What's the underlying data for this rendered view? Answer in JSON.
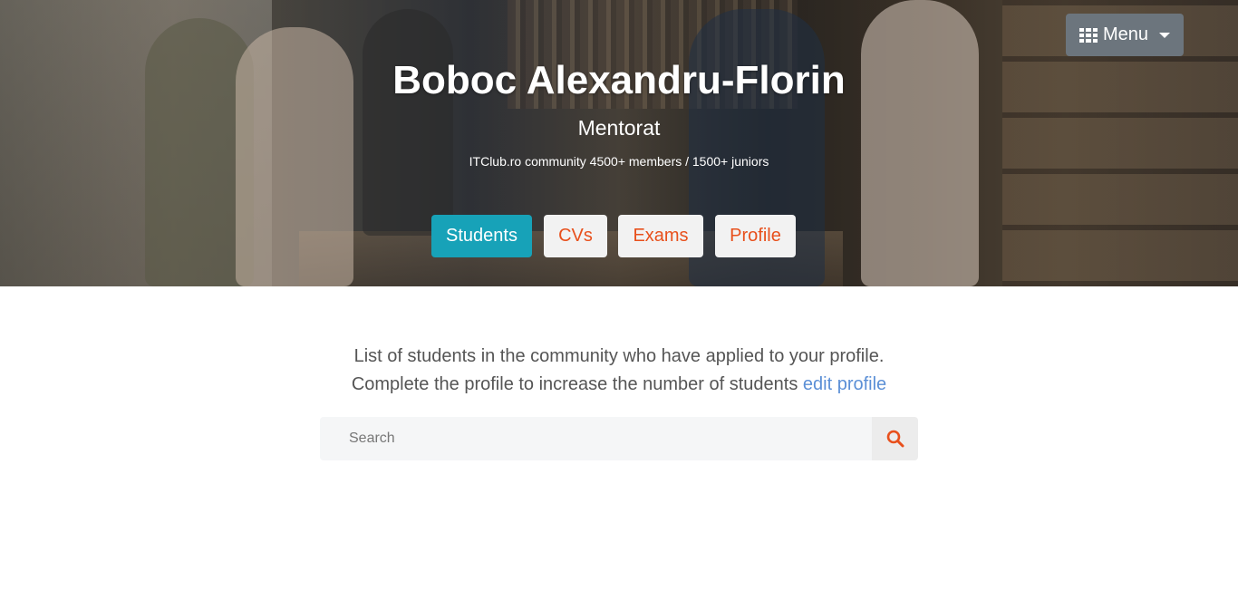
{
  "header": {
    "menu_label": "Menu",
    "title": "Boboc Alexandru-Florin",
    "subtitle": "Mentorat",
    "tagline": "ITClub.ro community 4500+ members / 1500+ juniors"
  },
  "nav": {
    "students": "Students",
    "cvs": "CVs",
    "exams": "Exams",
    "profile": "Profile"
  },
  "content": {
    "line1": "List of students in the community who have applied to your profile.",
    "line2": "Complete the profile to increase the number of students",
    "edit_link": "edit profile"
  },
  "search": {
    "placeholder": "Search"
  },
  "colors": {
    "accent": "#17a2b8",
    "link": "#5b8fd6",
    "nav_text": "#e8501c",
    "menu_bg": "#6c757d"
  }
}
